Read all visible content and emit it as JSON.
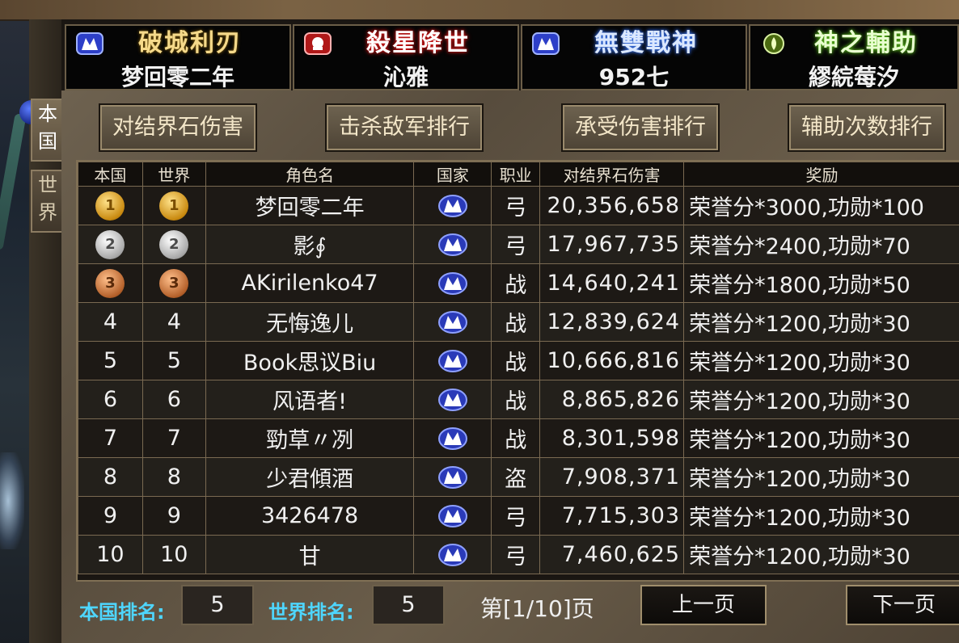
{
  "titles": [
    {
      "title": "破城利刃",
      "name": "梦回零二年",
      "style": "gold"
    },
    {
      "title": "殺星降世",
      "name": "沁雅",
      "style": "red"
    },
    {
      "title": "無雙戰神",
      "name": "952七",
      "style": "blue"
    },
    {
      "title": "神之輔助",
      "name": "繆綄莓汐",
      "style": "green"
    }
  ],
  "side_tabs": {
    "nation": "本\n国",
    "world": "世\n界"
  },
  "categories": [
    "对结界石伤害",
    "击杀敌军排行",
    "承受伤害排行",
    "辅助次数排行"
  ],
  "table": {
    "headers": [
      "本国",
      "世界",
      "角色名",
      "国家",
      "职业",
      "对结界石伤害",
      "奖励"
    ],
    "rows": [
      {
        "nation_rank": "1",
        "world_rank": "1",
        "medal": "gold",
        "name": "梦回零二年",
        "job": "弓",
        "damage": "20,356,658",
        "reward": "荣誉分*3000,功勋*100"
      },
      {
        "nation_rank": "2",
        "world_rank": "2",
        "medal": "silver",
        "name": "影∮",
        "job": "弓",
        "damage": "17,967,735",
        "reward": "荣誉分*2400,功勋*70"
      },
      {
        "nation_rank": "3",
        "world_rank": "3",
        "medal": "bronze",
        "name": "AKirilenko47",
        "job": "战",
        "damage": "14,640,241",
        "reward": "荣誉分*1800,功勋*50"
      },
      {
        "nation_rank": "4",
        "world_rank": "4",
        "medal": "",
        "name": "无悔逸儿",
        "job": "战",
        "damage": "12,839,624",
        "reward": "荣誉分*1200,功勋*30"
      },
      {
        "nation_rank": "5",
        "world_rank": "5",
        "medal": "",
        "name": "Book思议Biu",
        "job": "战",
        "damage": "10,666,816",
        "reward": "荣誉分*1200,功勋*30"
      },
      {
        "nation_rank": "6",
        "world_rank": "6",
        "medal": "",
        "name": "风语者!",
        "job": "战",
        "damage": "8,865,826",
        "reward": "荣誉分*1200,功勋*30"
      },
      {
        "nation_rank": "7",
        "world_rank": "7",
        "medal": "",
        "name": "勁草〃冽",
        "job": "战",
        "damage": "8,301,598",
        "reward": "荣誉分*1200,功勋*30"
      },
      {
        "nation_rank": "8",
        "world_rank": "8",
        "medal": "",
        "name": "少君傾酒",
        "job": "盗",
        "damage": "7,908,371",
        "reward": "荣誉分*1200,功勋*30"
      },
      {
        "nation_rank": "9",
        "world_rank": "9",
        "medal": "",
        "name": "3426478",
        "job": "弓",
        "damage": "7,715,303",
        "reward": "荣誉分*1200,功勋*30"
      },
      {
        "nation_rank": "10",
        "world_rank": "10",
        "medal": "",
        "name": "甘",
        "job": "弓",
        "damage": "7,460,625",
        "reward": "荣誉分*1200,功勋*30"
      }
    ]
  },
  "footer": {
    "nation_rank_label": "本国排名:",
    "nation_rank_value": "5",
    "world_rank_label": "世界排名:",
    "world_rank_value": "5",
    "page_info": "第[1/10]页",
    "prev_label": "上一页",
    "next_label": "下一页"
  },
  "colors": {
    "cyan_label": "#4ed6ff",
    "nation_icon": "#3a4fd8"
  }
}
